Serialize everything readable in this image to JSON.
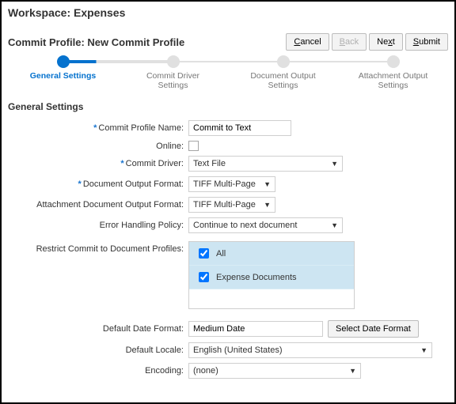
{
  "workspace_title": "Workspace: Expenses",
  "profile_title": "Commit Profile: New Commit Profile",
  "buttons": {
    "cancel": "Cancel",
    "back": "Back",
    "next": "Next",
    "submit": "Submit"
  },
  "steps": [
    {
      "label": "General Settings",
      "active": true
    },
    {
      "label": "Commit Driver Settings",
      "active": false
    },
    {
      "label": "Document Output Settings",
      "active": false
    },
    {
      "label": "Attachment Output Settings",
      "active": false
    }
  ],
  "section_heading": "General Settings",
  "fields": {
    "name": {
      "label": "Commit Profile Name:",
      "value": "Commit to Text",
      "required": true
    },
    "online": {
      "label": "Online:",
      "checked": false
    },
    "driver": {
      "label": "Commit Driver:",
      "value": "Text File",
      "required": true
    },
    "docfmt": {
      "label": "Document Output Format:",
      "value": "TIFF Multi-Page",
      "required": true
    },
    "attfmt": {
      "label": "Attachment Document Output Format:",
      "value": "TIFF Multi-Page"
    },
    "errpol": {
      "label": "Error Handling Policy:",
      "value": "Continue to next document"
    },
    "restrict": {
      "label": "Restrict Commit to Document Profiles:",
      "options": [
        {
          "label": "All",
          "checked": true
        },
        {
          "label": "Expense Documents",
          "checked": true
        }
      ]
    },
    "datefmt": {
      "label": "Default Date Format:",
      "value": "Medium Date",
      "button": "Select Date Format"
    },
    "locale": {
      "label": "Default Locale:",
      "value": "English (United States)"
    },
    "encoding": {
      "label": "Encoding:",
      "value": "(none)"
    }
  }
}
